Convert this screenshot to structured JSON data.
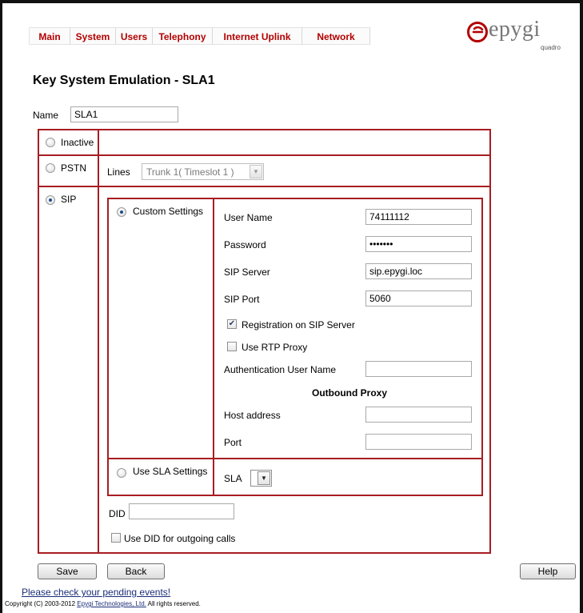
{
  "menu": {
    "items": [
      {
        "label": "Main"
      },
      {
        "label": "System"
      },
      {
        "label": "Users"
      },
      {
        "label": "Telephony"
      },
      {
        "label": "Internet Uplink"
      },
      {
        "label": "Network"
      }
    ]
  },
  "brand": {
    "name": "epygi",
    "subtitle": "quadro",
    "accent": "#b30000",
    "icon": "epygi-logo-icon"
  },
  "page": {
    "title": "Key System Emulation - SLA1"
  },
  "name_field": {
    "label": "Name",
    "value": "SLA1"
  },
  "modes": {
    "inactive": {
      "label": "Inactive",
      "selected": false
    },
    "pstn": {
      "label": "PSTN",
      "selected": false,
      "lines_label": "Lines",
      "lines_value": "Trunk 1( Timeslot 1 )"
    },
    "sip": {
      "label": "SIP",
      "selected": true
    }
  },
  "custom_settings": {
    "label": "Custom Settings",
    "selected": true,
    "user_name": {
      "label": "User Name",
      "value": "74111112"
    },
    "password": {
      "label": "Password",
      "value": "•••••••"
    },
    "sip_server": {
      "label": "SIP Server",
      "value": "sip.epygi.loc"
    },
    "sip_port": {
      "label": "SIP Port",
      "value": "5060"
    },
    "registration": {
      "label": "Registration on SIP Server",
      "checked": true
    },
    "rtp_proxy": {
      "label": "Use RTP Proxy",
      "checked": false
    },
    "auth_user": {
      "label": "Authentication User Name",
      "value": ""
    },
    "outbound_proxy": {
      "title": "Outbound Proxy",
      "host_label": "Host address",
      "host_value": "",
      "port_label": "Port",
      "port_value": ""
    }
  },
  "sla_settings": {
    "label": "Use SLA Settings",
    "selected": false,
    "sla_label": "SLA",
    "sla_value": ""
  },
  "did": {
    "label": "DID",
    "value": "",
    "use_for_outgoing_label": "Use DID for outgoing calls",
    "use_for_outgoing_checked": false
  },
  "buttons": {
    "save": "Save",
    "back": "Back",
    "help": "Help"
  },
  "footer": {
    "pending_link": "Please check your pending events!",
    "copyright_prefix": "Copyright (C) 2003-2012",
    "company": "Epygi Technologies, Ltd.",
    "copyright_suffix": "All rights reserved."
  },
  "colors": {
    "border": "#a71d22",
    "menu_text": "#b30000",
    "link": "#1b2e78"
  }
}
